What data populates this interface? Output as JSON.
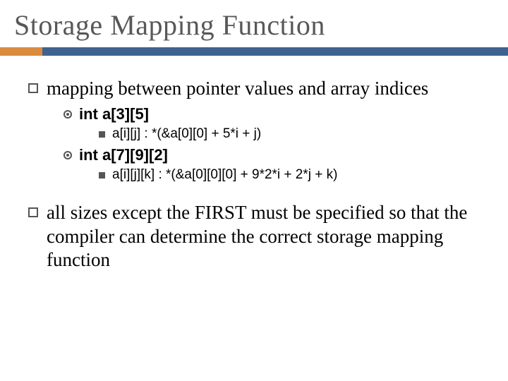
{
  "title": "Storage Mapping Function",
  "bullet1": "mapping between pointer values and array indices",
  "sub1": "int  a[3][5]",
  "sub1a": "a[i][j] : *(&a[0][0] + 5*i + j)",
  "sub2": "int a[7][9][2]",
  "sub2a": "a[i][j][k] : *(&a[0][0][0] + 9*2*i + 2*j + k)",
  "bullet2": "all sizes except the FIRST must be specified so that the compiler can determine the correct storage mapping function"
}
